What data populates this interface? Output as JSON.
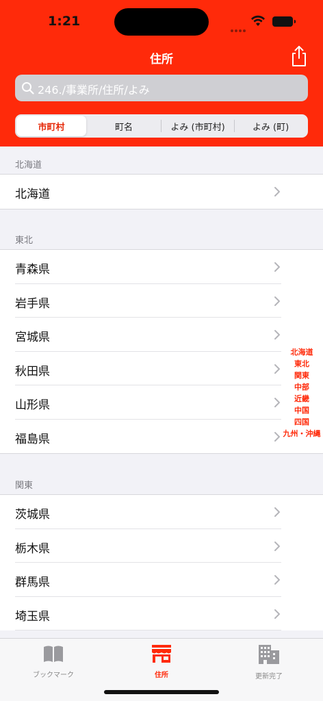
{
  "status": {
    "time": "1:21"
  },
  "nav": {
    "title": "住所"
  },
  "search": {
    "placeholder": "246./事業所/住所/よみ"
  },
  "segments": [
    "市町村",
    "町名",
    "よみ (市町村)",
    "よみ (町)"
  ],
  "sections": [
    {
      "header": "北海道",
      "items": [
        "北海道"
      ]
    },
    {
      "header": "東北",
      "items": [
        "青森県",
        "岩手県",
        "宮城県",
        "秋田県",
        "山形県",
        "福島県"
      ]
    },
    {
      "header": "関東",
      "items": [
        "茨城県",
        "栃木県",
        "群馬県",
        "埼玉県"
      ]
    }
  ],
  "index": [
    "北海道",
    "東北",
    "関東",
    "中部",
    "近畿",
    "中国",
    "四国",
    "九州・沖縄"
  ],
  "tabs": [
    {
      "label": "ブックマーク",
      "icon": "book-icon"
    },
    {
      "label": "住所",
      "icon": "store-icon"
    },
    {
      "label": "更新完了",
      "icon": "building-icon"
    }
  ],
  "colors": {
    "accent": "#ff2a0a",
    "background": "#f2f2f7"
  }
}
